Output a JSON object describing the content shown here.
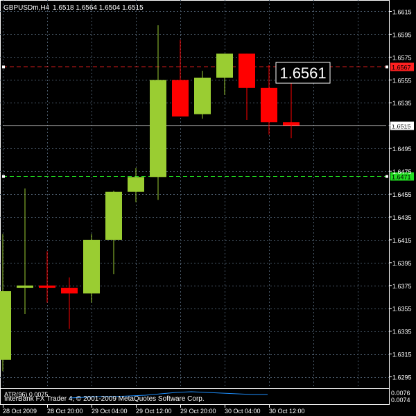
{
  "header": {
    "symbol_timeframe": "GBPUSDm,H4",
    "ohlc_text": "1.6518 1.6564 1.6504 1.6515"
  },
  "watermark": "InterBank FX Trader 4, © 2001-2009 MetaQuotes Software Corp.",
  "indicator": {
    "label": "ATR(96) 0.0075",
    "axis_top": "0.0076",
    "axis_bottom": "0.0074"
  },
  "price_axis": {
    "ticks": [
      "1.6615",
      "1.6595",
      "1.6575",
      "1.6555",
      "1.6535",
      "1.6515",
      "1.6495",
      "1.6475",
      "1.6455",
      "1.6435",
      "1.6415",
      "1.6395",
      "1.6375",
      "1.6355",
      "1.6335",
      "1.6315",
      "1.6295"
    ],
    "red_level_text": "1.6567",
    "green_level_text": "1.6471",
    "current_price_text": "1.6515",
    "crosshair_price_text": "1.6561"
  },
  "time_axis": {
    "labels": [
      "28 Oct 2009",
      "28 Oct 20:00",
      "29 Oct 04:00",
      "29 Oct 12:00",
      "29 Oct 20:00",
      "30 Oct 04:00",
      "30 Oct 12:00"
    ]
  },
  "colors": {
    "background": "#000000",
    "grid": "#4a5a6a",
    "bull": "#9acd32",
    "bear": "#ff0000",
    "axis_text": "#ffffff",
    "red_level": "#ff2020",
    "green_level": "#20dd20",
    "atr_line": "#1e90ff"
  },
  "chart_data": {
    "type": "candlestick",
    "series_candles": [
      {
        "o": 1.631,
        "h": 1.642,
        "l": 1.63,
        "c": 1.637
      },
      {
        "o": 1.6373,
        "h": 1.646,
        "l": 1.635,
        "c": 1.6375
      },
      {
        "o": 1.6375,
        "h": 1.6405,
        "l": 1.636,
        "c": 1.6373
      },
      {
        "o": 1.6373,
        "h": 1.6382,
        "l": 1.6337,
        "c": 1.6368
      },
      {
        "o": 1.6368,
        "h": 1.642,
        "l": 1.636,
        "c": 1.6415
      },
      {
        "o": 1.6415,
        "h": 1.6458,
        "l": 1.6385,
        "c": 1.6457
      },
      {
        "o": 1.6457,
        "h": 1.6478,
        "l": 1.6448,
        "c": 1.647
      },
      {
        "o": 1.647,
        "h": 1.6603,
        "l": 1.645,
        "c": 1.6555
      },
      {
        "o": 1.6555,
        "h": 1.659,
        "l": 1.6525,
        "c": 1.6523
      },
      {
        "o": 1.6525,
        "h": 1.6563,
        "l": 1.6521,
        "c": 1.6557
      },
      {
        "o": 1.6557,
        "h": 1.6578,
        "l": 1.6542,
        "c": 1.6578
      },
      {
        "o": 1.6578,
        "h": 1.6578,
        "l": 1.652,
        "c": 1.6548
      },
      {
        "o": 1.6548,
        "h": 1.6568,
        "l": 1.6507,
        "c": 1.6518
      },
      {
        "o": 1.6518,
        "h": 1.6564,
        "l": 1.6504,
        "c": 1.6515
      }
    ],
    "ylim": [
      1.6285,
      1.6625
    ]
  }
}
